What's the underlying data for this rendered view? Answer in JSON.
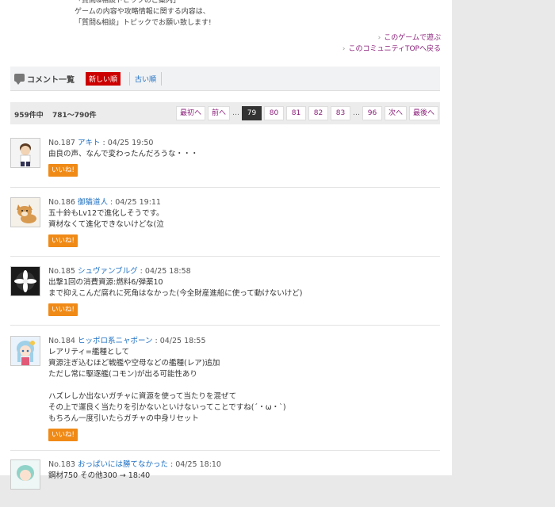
{
  "intro": {
    "lines": [
      "「質問&相談トピックのご案内」",
      "ゲームの内容や攻略情報に関する内容は、",
      "「質問&相談」トピックでお願い致します!"
    ]
  },
  "links": {
    "play_game": "このゲームで遊ぶ",
    "community_top": "このコミュニティTOPへ戻る"
  },
  "comments_header": {
    "title": "コメント一覧",
    "sort_new": "新しい順",
    "sort_old": "古い順"
  },
  "pager": {
    "total": "959件中",
    "range": "781〜790件",
    "first": "最初へ",
    "prev": "前へ",
    "ellipsis": "…",
    "pages": [
      "79",
      "80",
      "81",
      "82",
      "83"
    ],
    "current": "79",
    "last_page": "96",
    "next": "次へ",
    "last": "最後へ"
  },
  "comments": [
    {
      "no": "No.187",
      "user": "アキト",
      "time": "04/25 19:50",
      "lines": [
        "由良の声、なんで変わったんだろうな・・・"
      ],
      "like": "いいね!",
      "avatar": "boy-avatar"
    },
    {
      "no": "No.186",
      "user": "御猫道人",
      "time": "04/25 19:11",
      "lines": [
        "五十鈴もLv12で進化しそうです。",
        "資材なくて進化できないけどな(泣"
      ],
      "like": "いいね!",
      "avatar": "shiba-dog-avatar"
    },
    {
      "no": "No.185",
      "user": "シュヴァンブルグ",
      "time": "04/25 18:58",
      "lines": [
        "出撃1回の消費資源:燃料6/弾薬10",
        "まで抑えこんだ腐れに死角はなかった(今全財産進船に使って動けないけど)"
      ],
      "like": "いいね!",
      "avatar": "flower-avatar"
    },
    {
      "no": "No.184",
      "user": "ヒッポロ系ニャポーン",
      "time": "04/25 18:55",
      "lines": [
        "レアリティ=艦種として",
        "資源注ぎ込むほど戦艦や空母などの艦種(レア)追加",
        "ただし常に駆逐艦(コモン)が出る可能性あり",
        "",
        "ハズレしか出ないガチャに資源を使って当たりを混ぜて",
        "その上で運良く当たりを引かないといけないってことですね(´・ω・`)",
        "もちろん一度引いたらガチャの中身リセット"
      ],
      "like": "いいね!",
      "avatar": "anime-girl-avatar"
    },
    {
      "no": "No.183",
      "user": "おっぱいには勝てなかった",
      "time": "04/25 18:10",
      "lines": [
        "鋼材750 その他300 → 18:40"
      ],
      "like": "いいね!",
      "avatar": "anime-girl-avatar-2"
    }
  ],
  "colors": {
    "sort_active": "#cc0000",
    "like_button": "#f08a17",
    "link": "#1d6fc2",
    "pager_link": "#8a1f7a",
    "current_page": "#333333"
  }
}
